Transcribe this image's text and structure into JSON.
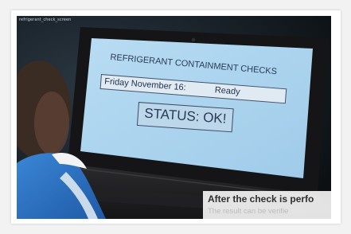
{
  "video": {
    "top_label": "refrigerant_check_screen",
    "screen": {
      "title": "REFRIGERANT CONTAINMENT CHECKS",
      "date": "Friday November 16:",
      "ready": "Ready",
      "status": "STATUS: OK!"
    },
    "caption": {
      "main": "After the check is perfo",
      "sub": "The result can be verifie"
    }
  },
  "colors": {
    "screen_bg": "#a9d2ee",
    "status_text": "#2b3a55",
    "jacket": "#2a6fc2",
    "frame_bg": "#ffffff"
  }
}
